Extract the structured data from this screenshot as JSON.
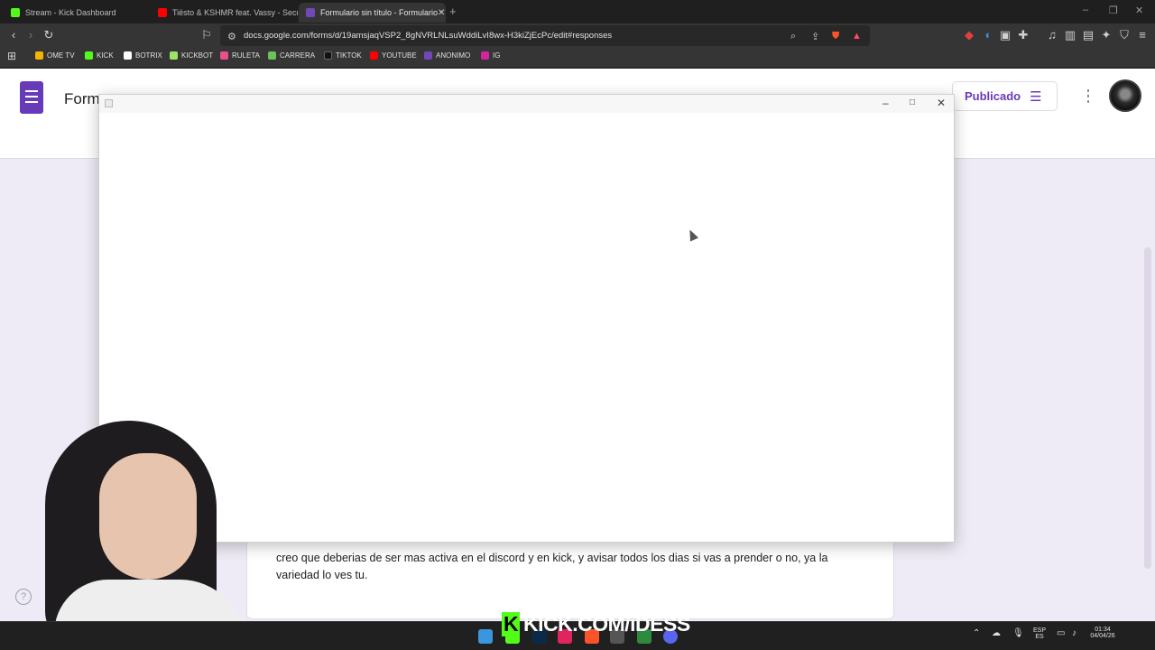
{
  "tabs": [
    {
      "title": "Stream - Kick Dashboard",
      "favicon_color": "#53fc18",
      "active": false
    },
    {
      "title": "Tiësto & KSHMR feat. Vassy - Secrets",
      "favicon_color": "#ff0000",
      "active": false
    },
    {
      "title": "Formulario sin título - Formulario",
      "favicon_color": "#7248b9",
      "active": true
    }
  ],
  "toolbar": {
    "url": "docs.google.com/forms/d/19amsjaqVSP2_8gNVRLNLsuWddiLvI8wx-H3kiZjEcPc/edit#responses"
  },
  "bookmarks": [
    {
      "label": "OME TV",
      "color": "#f4b400"
    },
    {
      "label": "KICK",
      "color": "#53fc18"
    },
    {
      "label": "BOTRIX",
      "color": "#ffffff"
    },
    {
      "label": "KICKBOT",
      "color": "#9be564"
    },
    {
      "label": "RULETA",
      "color": "#e94f8a"
    },
    {
      "label": "CARRERA",
      "color": "#6ac259"
    },
    {
      "label": "TIKTOK",
      "color": "#111111"
    },
    {
      "label": "YOUTUBE",
      "color": "#ff0000"
    },
    {
      "label": "ANONIMO",
      "color": "#7248b9"
    },
    {
      "label": "IG",
      "color": "#d6249f"
    }
  ],
  "forms": {
    "title": "Form",
    "publish_label": "Publicado",
    "accent": "#673ab7",
    "response_text": "creo que deberias de ser mas activa en el discord y en kick, y avisar todos los dias si vas a prender o no, ya la variedad lo ves tu."
  },
  "overlay": {
    "brand": "KICK.COM/iDESS",
    "brand_color": "#53fc18"
  },
  "taskbar": {
    "lang_top": "ESP",
    "lang_bottom": "ES",
    "time": "01:34",
    "date": "04/04/26"
  }
}
